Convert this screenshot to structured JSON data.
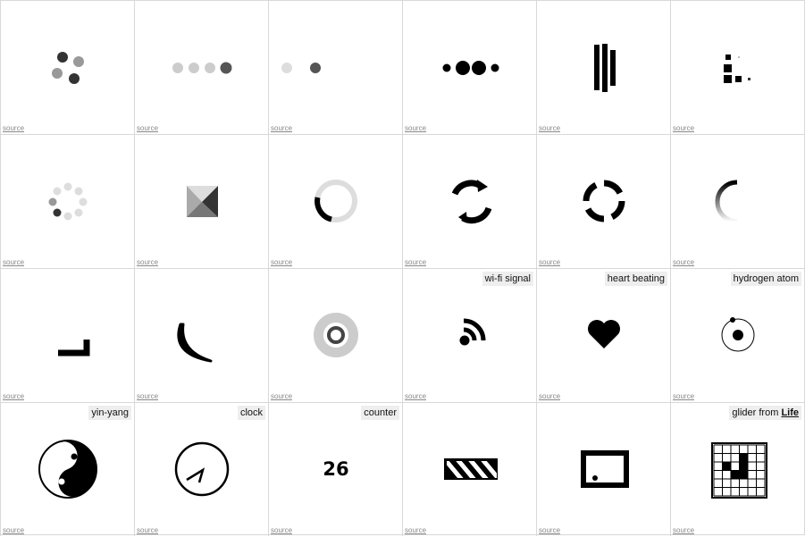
{
  "source_link": "source",
  "cells": [
    {
      "icon": "four-dots-spinner"
    },
    {
      "icon": "four-dots-row"
    },
    {
      "icon": "two-dots"
    },
    {
      "icon": "pulsing-dots"
    },
    {
      "icon": "bars"
    },
    {
      "icon": "squares"
    },
    {
      "icon": "dot-circle-spinner"
    },
    {
      "icon": "folding-square"
    },
    {
      "icon": "ring-spinner"
    },
    {
      "icon": "refresh-arrows"
    },
    {
      "icon": "broken-ring"
    },
    {
      "icon": "fading-arc"
    },
    {
      "icon": "corner-line"
    },
    {
      "icon": "crescent-arc"
    },
    {
      "icon": "concentric-rings"
    },
    {
      "icon": "wifi-signal",
      "label": "wi-fi signal"
    },
    {
      "icon": "heart",
      "label": "heart beating"
    },
    {
      "icon": "atom",
      "label": "hydrogen atom"
    },
    {
      "icon": "yin-yang",
      "label": "yin-yang"
    },
    {
      "icon": "clock",
      "label": "clock"
    },
    {
      "icon": "counter",
      "label": "counter",
      "value": "26"
    },
    {
      "icon": "striped-bar"
    },
    {
      "icon": "bouncing-ball-box"
    },
    {
      "icon": "glider-grid",
      "label": "glider from ",
      "label_link": "Life"
    }
  ],
  "colors": {
    "border": "#d8d8d8",
    "label_bg": "#eeeeee",
    "source": "#888888"
  }
}
